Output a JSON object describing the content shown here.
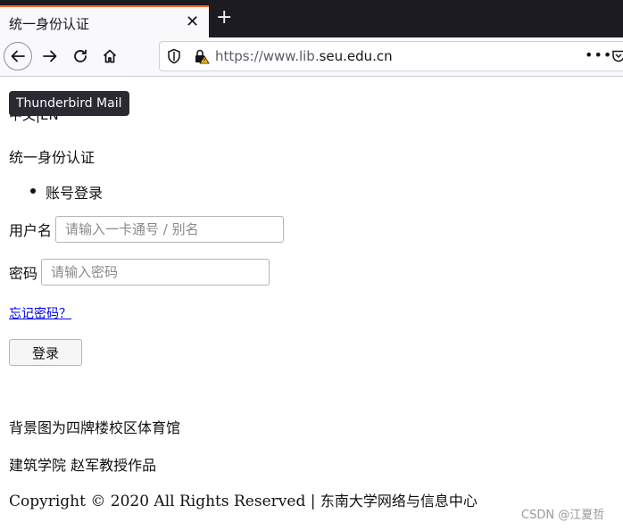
{
  "browser": {
    "tab": {
      "title": "统一身份认证",
      "close_glyph": "✕"
    },
    "new_tab_glyph": "+",
    "url": {
      "prefix": "https://www.lib.",
      "domain": "seu.edu.cn"
    },
    "more_glyph": "•••",
    "accent": "#ff6a2b"
  },
  "tooltip": {
    "text": "Thunderbird Mail"
  },
  "page": {
    "lang_switch": "中文|EN",
    "heading": "统一身份认证",
    "login_tabs": [
      "账号登录"
    ],
    "username": {
      "label": "用户名",
      "placeholder": "请输入一卡通号 / 别名"
    },
    "password": {
      "label": "密码",
      "placeholder": "请输入密码"
    },
    "forgot_link": "忘记密码？",
    "login_button": "登录",
    "footer": {
      "line1": "背景图为四牌楼校区体育馆",
      "line2": "建筑学院 赵军教授作品",
      "copyright": "Copyright © 2020 All Rights Reserved | ",
      "copyright_org": "东南大学网络与信息中心"
    }
  },
  "watermark": "CSDN @江夏哲"
}
